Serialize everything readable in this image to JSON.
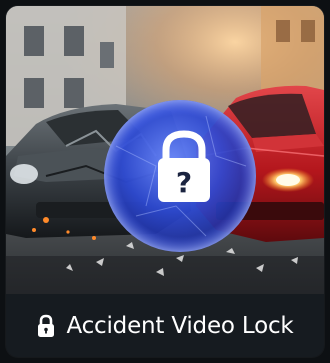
{
  "tile": {
    "title": "Accident Video Lock",
    "image_icon": "padlock-question-icon",
    "title_icon": "padlock-icon"
  },
  "colors": {
    "background": "#0d1013",
    "label_bar": "#161b20",
    "text": "#ffffff",
    "shield_blue": "#2f4fd6",
    "red_car": "#b8141a"
  }
}
